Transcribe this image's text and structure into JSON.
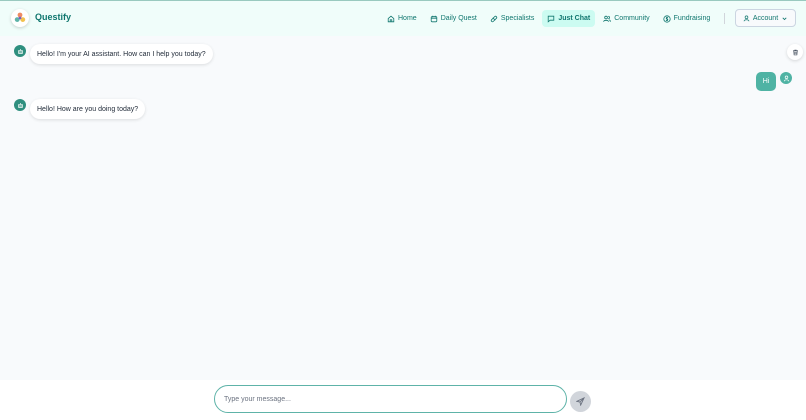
{
  "header": {
    "brand": "Questify",
    "nav": [
      {
        "label": "Home",
        "icon": "home-icon"
      },
      {
        "label": "Daily Quest",
        "icon": "calendar-icon"
      },
      {
        "label": "Specialists",
        "icon": "pill-icon"
      },
      {
        "label": "Just Chat",
        "icon": "chat-icon",
        "active": true
      },
      {
        "label": "Community",
        "icon": "users-icon"
      },
      {
        "label": "Fundraising",
        "icon": "dollar-circle-icon"
      }
    ],
    "account_label": "Account"
  },
  "chat": {
    "messages": [
      {
        "role": "assistant",
        "text": "Hello! I'm your AI assistant. How can I help you today?"
      },
      {
        "role": "user",
        "text": "Hi"
      },
      {
        "role": "assistant",
        "text": "Hello! How are you doing today?"
      }
    ]
  },
  "composer": {
    "value": "",
    "placeholder": "Type your message..."
  },
  "colors": {
    "accent": "#0f766e",
    "user_bubble": "#4fb3a4",
    "bot_avatar": "#2f8f7f",
    "header_bg": "#f0fdfa",
    "active_tab_bg": "#ccfbf1"
  }
}
